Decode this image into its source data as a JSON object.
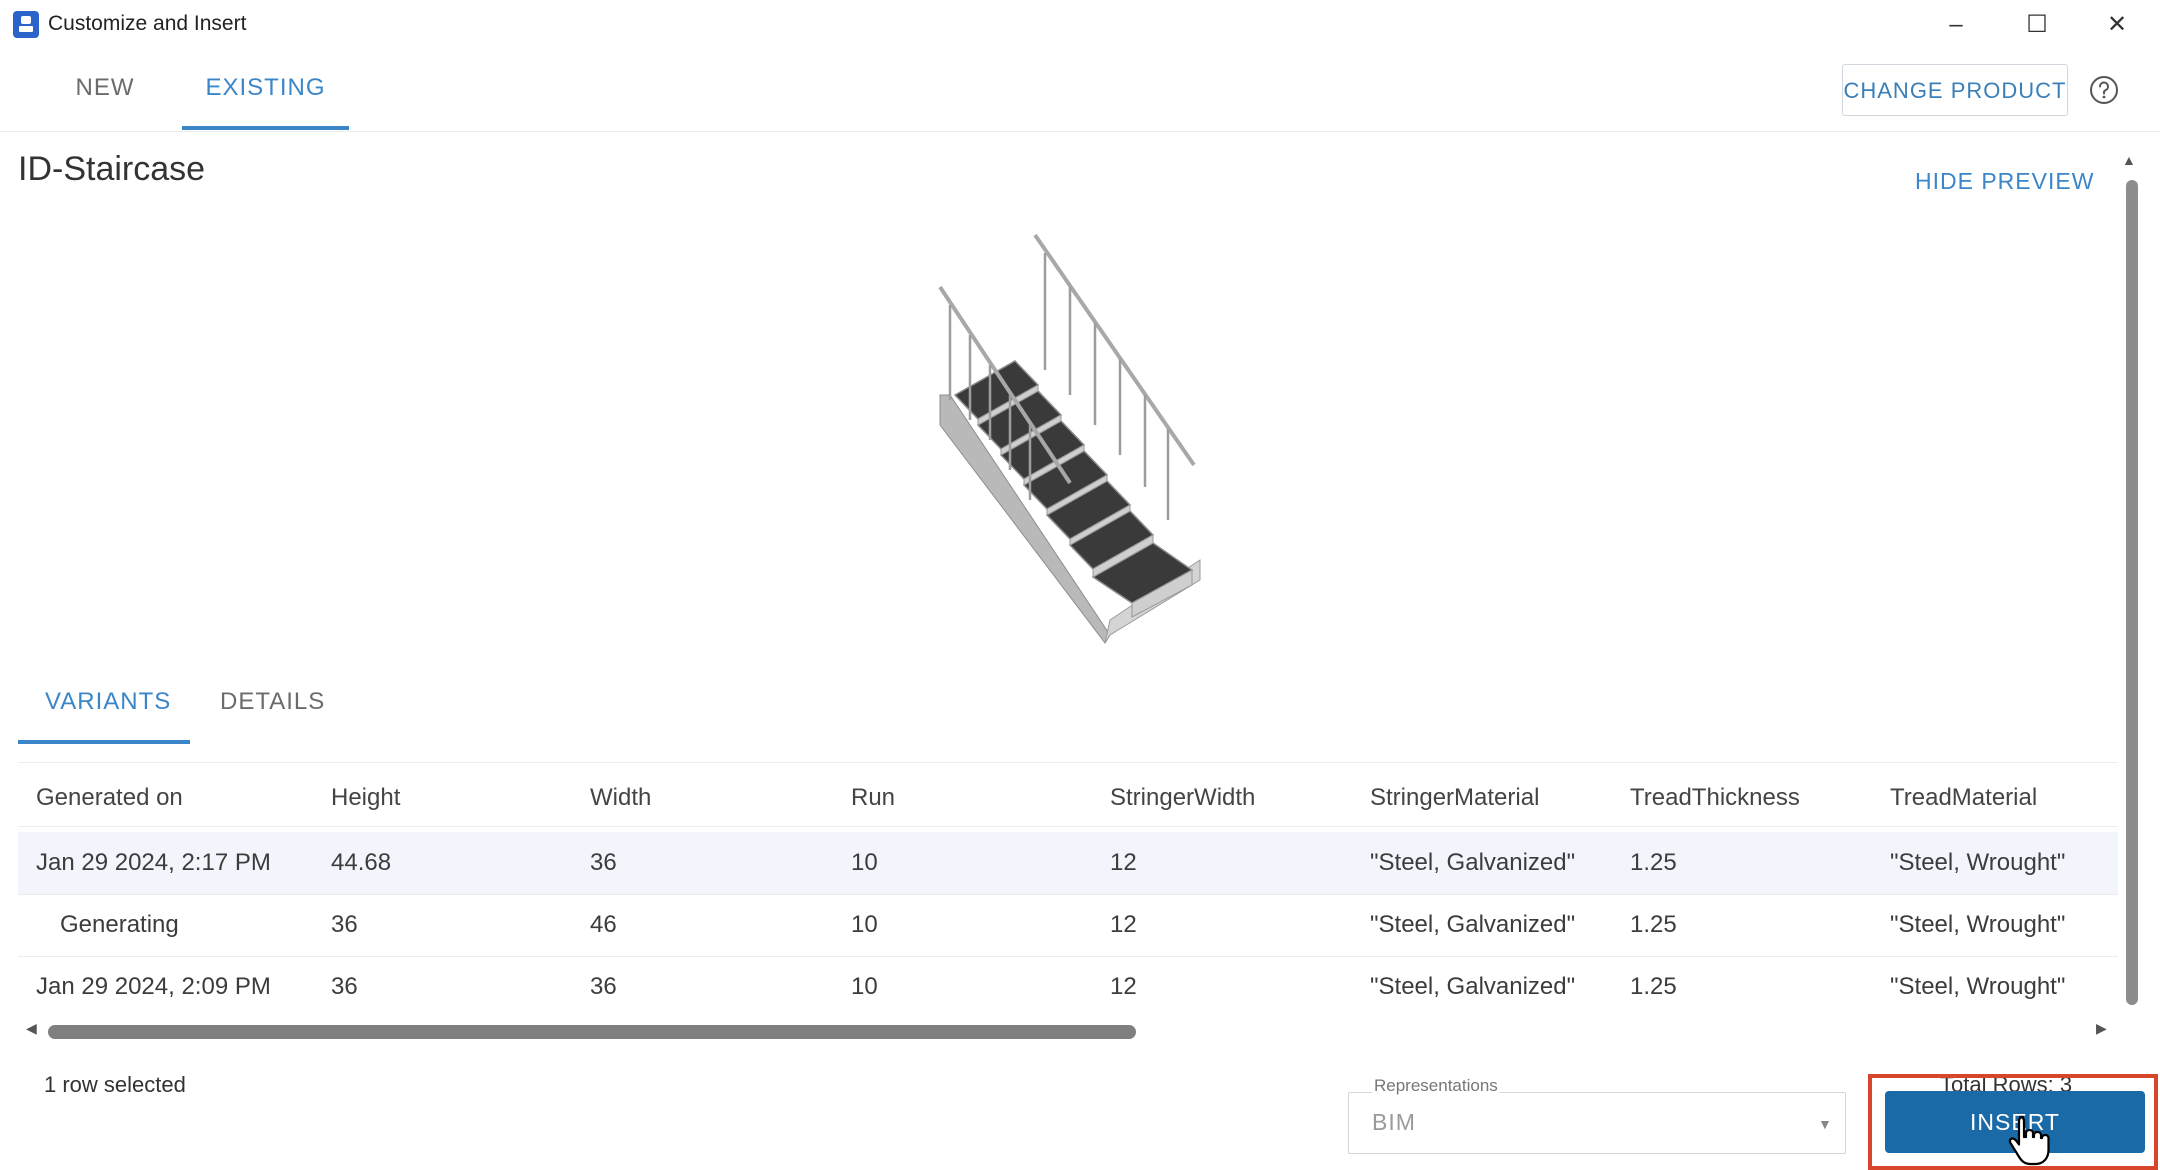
{
  "window": {
    "title": "Customize and Insert",
    "minimize_glyph": "–",
    "maximize_glyph": "☐",
    "close_glyph": "✕"
  },
  "top_tabs": [
    {
      "label": "NEW",
      "active": false
    },
    {
      "label": "EXISTING",
      "active": true
    }
  ],
  "header": {
    "change_product_label": "CHANGE PRODUCT",
    "help_icon": "help-circle-icon",
    "title": "ID-Staircase",
    "hide_preview_label": "HIDE PREVIEW"
  },
  "preview": {
    "icon": "staircase-model"
  },
  "inner_tabs": [
    {
      "label": "VARIANTS",
      "active": true
    },
    {
      "label": "DETAILS",
      "active": false
    }
  ],
  "table": {
    "columns": [
      "Generated on",
      "Height",
      "Width",
      "Run",
      "StringerWidth",
      "StringerMaterial",
      "TreadThickness",
      "TreadMaterial"
    ],
    "rows": [
      [
        "Jan 29 2024, 2:17 PM",
        "44.68",
        "36",
        "10",
        "12",
        "\"Steel, Galvanized\"",
        "1.25",
        "\"Steel, Wrought\""
      ],
      [
        "Generating",
        "36",
        "46",
        "10",
        "12",
        "\"Steel, Galvanized\"",
        "1.25",
        "\"Steel, Wrought\""
      ],
      [
        "Jan 29 2024, 2:09 PM",
        "36",
        "36",
        "10",
        "12",
        "\"Steel, Galvanized\"",
        "1.25",
        "\"Steel, Wrought\""
      ]
    ],
    "selected_row": 0
  },
  "footer": {
    "rows_selected": "1 row selected",
    "total_rows": "Total Rows: 3",
    "representations_label": "Representations",
    "representations_value": "BIM",
    "insert_label": "INSERT"
  },
  "colors": {
    "accent": "#3a86c8",
    "insert_button": "#196aa6",
    "highlight": "#d7462a"
  }
}
